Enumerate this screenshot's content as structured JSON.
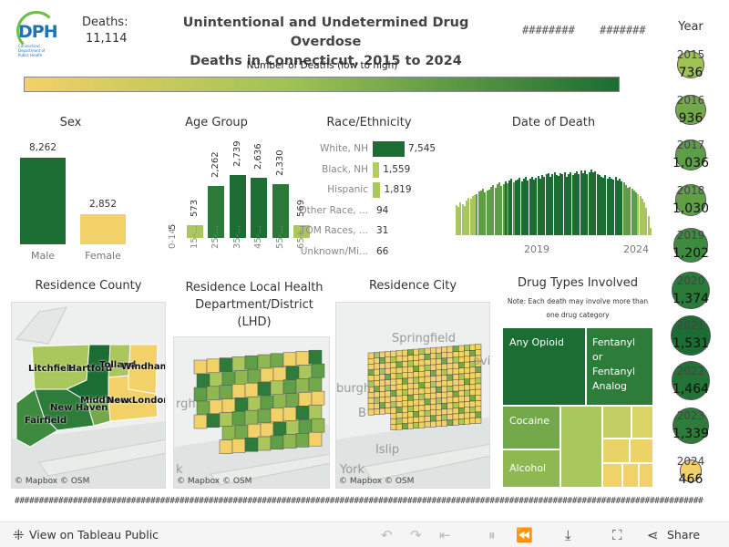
{
  "header": {
    "logo_text": "DPH",
    "logo_subtext": "Connecticut Department of Public Health",
    "deaths_label": "Deaths:",
    "deaths_value": "11,114",
    "title_line1": "Unintentional and Undetermined Drug Overdose",
    "title_line2": "Deaths in Connecticut, 2015 to 2024",
    "hash1": "########",
    "hash2": "#######",
    "year_label": "Year"
  },
  "legend": {
    "title": "Number of Deaths (low to high)",
    "color_low": "#f2d168",
    "color_high": "#1b6d34"
  },
  "sex": {
    "title": "Sex",
    "bars": [
      {
        "label": "Male",
        "value": "8,262",
        "n": 8262,
        "color": "#1b6d34"
      },
      {
        "label": "Female",
        "value": "2,852",
        "n": 2852,
        "color": "#f2d168"
      }
    ]
  },
  "age": {
    "title": "Age Group",
    "bars": [
      {
        "label": "0-14",
        "value": "5",
        "n": 5,
        "color": "#f2d168"
      },
      {
        "label": "15-...",
        "value": "573",
        "n": 573,
        "color": "#a9c75c"
      },
      {
        "label": "25-...",
        "value": "2,262",
        "n": 2262,
        "color": "#2f7a3b"
      },
      {
        "label": "35-...",
        "value": "2,739",
        "n": 2739,
        "color": "#1b6d34"
      },
      {
        "label": "45-...",
        "value": "2,636",
        "n": 2636,
        "color": "#1d6f35"
      },
      {
        "label": "55-...",
        "value": "2,330",
        "n": 2330,
        "color": "#2c7839"
      },
      {
        "label": "65+",
        "value": "569",
        "n": 569,
        "color": "#a9c75c"
      }
    ]
  },
  "race": {
    "title": "Race/Ethnicity",
    "rows": [
      {
        "label": "White, NH",
        "value": "7,545",
        "n": 7545,
        "color": "#1b6d34"
      },
      {
        "label": "Black, NH",
        "value": "1,559",
        "n": 1559,
        "color": "#b5cc61"
      },
      {
        "label": "Hispanic",
        "value": "1,819",
        "n": 1819,
        "color": "#a9c75c"
      },
      {
        "label": "Other Race, ...",
        "value": "94",
        "n": 94,
        "color": "#f2d168"
      },
      {
        "label": "TOM Races, ...",
        "value": "31",
        "n": 31,
        "color": "#f2d168"
      },
      {
        "label": "Unknown/Mi...",
        "value": "66",
        "n": 66,
        "color": "#f2d168"
      }
    ]
  },
  "date_of_death": {
    "title": "Date of Death",
    "tick1": "2019",
    "tick2": "2024",
    "monthly": [
      48,
      45,
      52,
      50,
      47,
      55,
      60,
      58,
      62,
      64,
      66,
      70,
      72,
      75,
      68,
      71,
      73,
      78,
      80,
      76,
      82,
      85,
      79,
      81,
      86,
      83,
      88,
      90,
      84,
      87,
      89,
      92,
      86,
      91,
      93,
      88,
      90,
      94,
      89,
      92,
      95,
      91,
      96,
      93,
      97,
      99,
      94,
      98,
      100,
      96,
      95,
      99,
      97,
      100,
      93,
      98,
      101,
      96,
      99,
      102,
      97,
      104,
      99,
      103,
      98,
      101,
      105,
      100,
      102,
      98,
      96,
      94,
      92,
      96,
      90,
      94,
      91,
      89,
      93,
      88,
      90,
      86,
      84,
      80,
      76,
      78,
      74,
      71,
      68,
      65,
      62,
      58,
      52,
      44,
      30,
      12
    ]
  },
  "maps": {
    "county_title": "Residence County",
    "lhd_title_line1": "Residence Local Health",
    "lhd_title_line2": "Department/District",
    "lhd_title_line3": "(LHD)",
    "city_title": "Residence City",
    "credit": "© Mapbox  © OSM",
    "county_labels": {
      "litchfield": "Litchfield",
      "hartford": "Hartford",
      "tolland": "Tolland",
      "windham": "Windham",
      "middlesex": "Middlesex",
      "new_london": "New London",
      "new_haven": "New Haven",
      "fairfield": "Fairfield"
    },
    "lhd_bg_text1": "rgh",
    "lhd_bg_text2": "k",
    "city_bg_springfield": "Springfield",
    "city_bg_ovi": "ovi",
    "city_bg_burgh": "burgh",
    "city_bg_islip": "Islip",
    "city_bg_york": "York",
    "city_bg_b": "B"
  },
  "drug_types": {
    "title": "Drug Types Involved",
    "note_line1": "Note: Each death may involve more than",
    "note_line2": "one drug category",
    "cells": {
      "any_opioid": "Any Opioid",
      "fentanyl_1": "Fentanyl",
      "fentanyl_2": "or",
      "fentanyl_3": "Fentanyl",
      "fentanyl_4": "Analog",
      "cocaine": "Cocaine",
      "alcohol": "Alcohol"
    }
  },
  "years": [
    {
      "year": "2015",
      "value": "736",
      "color": "#9fc255"
    },
    {
      "year": "2016",
      "value": "936",
      "color": "#74a94b"
    },
    {
      "year": "2017",
      "value": "1,036",
      "color": "#5e9e46"
    },
    {
      "year": "2018",
      "value": "1,030",
      "color": "#5f9f46"
    },
    {
      "year": "2019",
      "value": "1,202",
      "color": "#3e8a3e"
    },
    {
      "year": "2020",
      "value": "1,374",
      "color": "#2a7a39"
    },
    {
      "year": "2021",
      "value": "1,531",
      "color": "#1b6d34"
    },
    {
      "year": "2022",
      "value": "1,464",
      "color": "#227336"
    },
    {
      "year": "2023",
      "value": "1,339",
      "color": "#2e7c3a"
    },
    {
      "year": "2024",
      "value": "466",
      "color": "#f2d168"
    }
  ],
  "footer": {
    "hash_line": "##############################################################################################################################################",
    "view_link": "View on Tableau Public",
    "share": "Share"
  }
}
